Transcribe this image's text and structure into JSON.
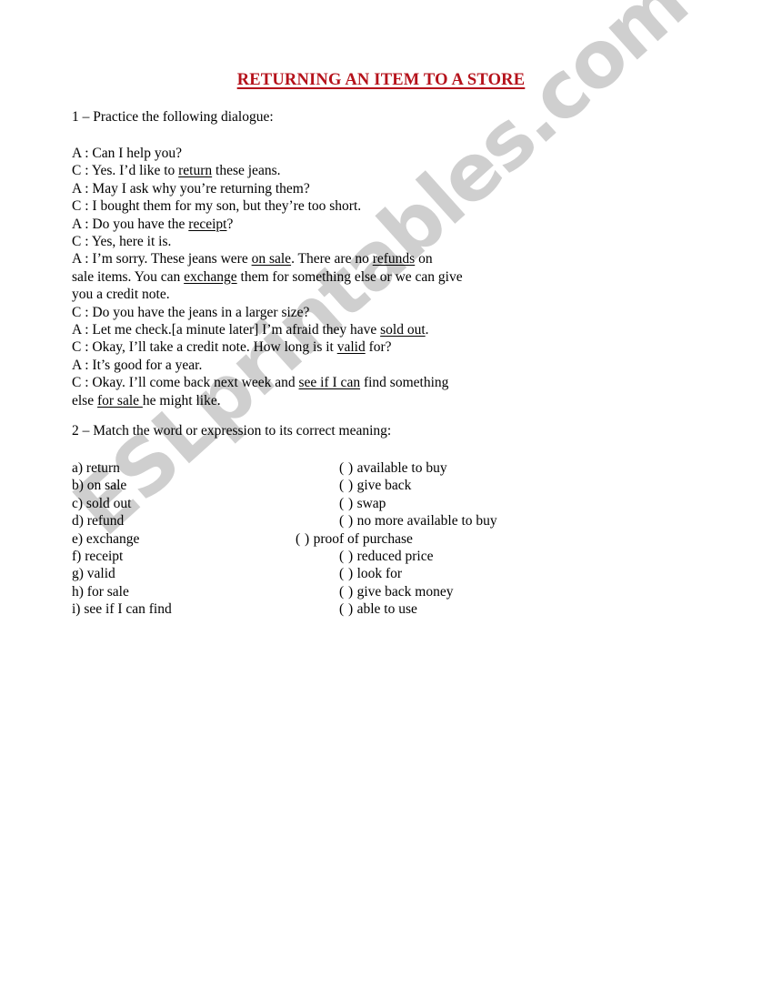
{
  "page": {
    "title": "RETURNING AN ITEM TO A STORE",
    "title_color": "#b5121b",
    "background_color": "#ffffff",
    "text_color": "#000000"
  },
  "watermark": {
    "text": "ESLprintables.com",
    "color": "#cfcfcf",
    "rotation_degrees": -42
  },
  "task1": {
    "heading": "1 – Practice the following dialogue:",
    "dialogue": [
      {
        "speaker": "A",
        "line": "Can I help you?"
      },
      {
        "speaker": "C",
        "line": "Yes. I’d like to return these jeans."
      },
      {
        "speaker": "A",
        "line": "May I ask why you’re returning them?"
      },
      {
        "speaker": "C",
        "line": "I bought them for my son, but they’re too short."
      },
      {
        "speaker": "A",
        "line": "Do you have the receipt?"
      },
      {
        "speaker": "C",
        "line": "Yes, here it is."
      },
      {
        "speaker": "A",
        "line": "I’m sorry. These jeans were on sale. There are no refunds on sale items. You can exchange them for something else or we can give you a credit note."
      },
      {
        "speaker": "C",
        "line": "Do you have the jeans in a larger size?"
      },
      {
        "speaker": "A",
        "line": "Let me check.[a minute later] I’m afraid they have sold out."
      },
      {
        "speaker": "C",
        "line": "Okay, I’ll take a credit note. How long is it valid for?"
      },
      {
        "speaker": "A",
        "line": "It’s good for a year."
      },
      {
        "speaker": "C",
        "line": "Okay. I’ll come back next week and see if I can find something else for sale he might like."
      }
    ],
    "line_parts": [
      {
        "prefix": "A : ",
        "segments": [
          {
            "t": "Can I help you?",
            "u": false
          }
        ]
      },
      {
        "prefix": "C : ",
        "segments": [
          {
            "t": "Yes. I’d like to ",
            "u": false
          },
          {
            "t": "return",
            "u": true
          },
          {
            "t": " these jeans.",
            "u": false
          }
        ]
      },
      {
        "prefix": "A : ",
        "segments": [
          {
            "t": "May I ask why you’re returning them?",
            "u": false
          }
        ]
      },
      {
        "prefix": "C : ",
        "segments": [
          {
            "t": "I bought them for my son, but they’re too short.",
            "u": false
          }
        ]
      },
      {
        "prefix": "A : ",
        "segments": [
          {
            "t": "Do you have the ",
            "u": false
          },
          {
            "t": "receipt",
            "u": true
          },
          {
            "t": "?",
            "u": false
          }
        ]
      },
      {
        "prefix": "C : ",
        "segments": [
          {
            "t": "Yes, here it is.",
            "u": false
          }
        ]
      },
      {
        "prefix": "A : ",
        "segments": [
          {
            "t": "I’m sorry. These jeans were ",
            "u": false
          },
          {
            "t": "on sale",
            "u": true
          },
          {
            "t": ". There are no ",
            "u": false
          },
          {
            "t": "refunds",
            "u": true
          },
          {
            "t": " on",
            "u": false
          }
        ]
      },
      {
        "prefix": "",
        "segments": [
          {
            "t": "sale items. You can ",
            "u": false
          },
          {
            "t": "exchange",
            "u": true
          },
          {
            "t": " them for something else or we can give",
            "u": false
          }
        ]
      },
      {
        "prefix": "",
        "segments": [
          {
            "t": "you a credit note.",
            "u": false
          }
        ]
      },
      {
        "prefix": "C : ",
        "segments": [
          {
            "t": "Do you have the jeans in a larger size?",
            "u": false
          }
        ]
      },
      {
        "prefix": "A : ",
        "segments": [
          {
            "t": "Let me check.[a minute later] I’m afraid they have ",
            "u": false
          },
          {
            "t": "sold out",
            "u": true
          },
          {
            "t": ".",
            "u": false
          }
        ]
      },
      {
        "prefix": "C : ",
        "segments": [
          {
            "t": "Okay, I’ll take a credit note. How long is it ",
            "u": false
          },
          {
            "t": "valid",
            "u": true
          },
          {
            "t": " for?",
            "u": false
          }
        ]
      },
      {
        "prefix": "A : ",
        "segments": [
          {
            "t": "It’s good for a year.",
            "u": false
          }
        ]
      },
      {
        "prefix": "C : ",
        "segments": [
          {
            "t": "Okay. I’ll come back next week and ",
            "u": false
          },
          {
            "t": "see if I can",
            "u": true
          },
          {
            "t": " find something",
            "u": false
          }
        ]
      },
      {
        "prefix": "",
        "segments": [
          {
            "t": "else ",
            "u": false
          },
          {
            "t": "for sale ",
            "u": true
          },
          {
            "t": "he might like.",
            "u": false
          }
        ]
      }
    ]
  },
  "task2": {
    "heading": "2 – Match the word or expression to its correct meaning:",
    "blank": "(    )",
    "rows": [
      {
        "term": "a) return",
        "definition": "available to buy",
        "shifted": false
      },
      {
        "term": "b) on sale",
        "definition": "give back",
        "shifted": false
      },
      {
        "term": "c) sold out",
        "definition": "swap",
        "shifted": false
      },
      {
        "term": "d) refund",
        "definition": "no more available to buy",
        "shifted": false
      },
      {
        "term": "e) exchange",
        "definition": "proof of purchase",
        "shifted": true
      },
      {
        "term": "f) receipt",
        "definition": "reduced price",
        "shifted": false
      },
      {
        "term": "g) valid",
        "definition": "look for",
        "shifted": false
      },
      {
        "term": "h) for sale",
        "definition": "give back money",
        "shifted": false
      },
      {
        "term": "i) see if I can find",
        "definition": "able to use",
        "shifted": false
      }
    ]
  }
}
